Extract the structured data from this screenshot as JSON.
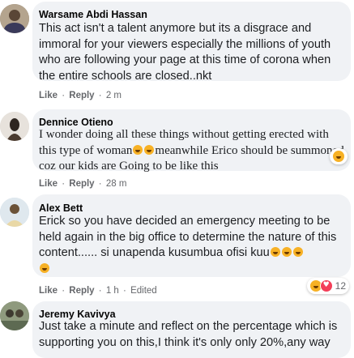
{
  "comments": [
    {
      "author": "Warsame Abdi Hassan",
      "text": "This act isn't a talent anymore but its a disgrace and immoral for your viewers especially the millions of youth who are following your page at this time of corona when the entire schools are closed..nkt",
      "like": "Like",
      "reply": "Reply",
      "time": "2 m",
      "edited": "",
      "reaction_count": "",
      "avatar_color": "#8a7b6b"
    },
    {
      "author": "Dennice Otieno",
      "text_parts": [
        "I wonder doing all these things without getting erected with this type of woman",
        "meanwhile Erico should be summoned coz our kids are Going to be like this"
      ],
      "like": "Like",
      "reply": "Reply",
      "time": "28 m",
      "edited": "",
      "reaction_count": "",
      "avatar_color": "#d8d2cc"
    },
    {
      "author": "Alex Bett",
      "text": "Erick so you have decided an emergency meeting to be held again in the big office to determine the nature of this content...... si unapenda kusumbua ofisi kuu",
      "like": "Like",
      "reply": "Reply",
      "time": "1 h",
      "edited": "Edited",
      "reaction_count": "12",
      "avatar_color": "#c9d9e6"
    },
    {
      "author": "Jeremy Kavivya",
      "text": "Just take a minute and reflect on the percentage which is supporting you on this,I think it's only only 20%,any way",
      "like": "",
      "reply": "",
      "time": "",
      "edited": "",
      "reaction_count": "",
      "avatar_color": "#7c8a6e"
    }
  ],
  "colors": {
    "bubble": "#f0f2f5",
    "meta": "#65676b",
    "haha": "#f7b125",
    "love": "#f33e58"
  },
  "icons": {
    "haha_reaction": "haha-emoji-icon",
    "love_reaction": "love-heart-icon"
  }
}
